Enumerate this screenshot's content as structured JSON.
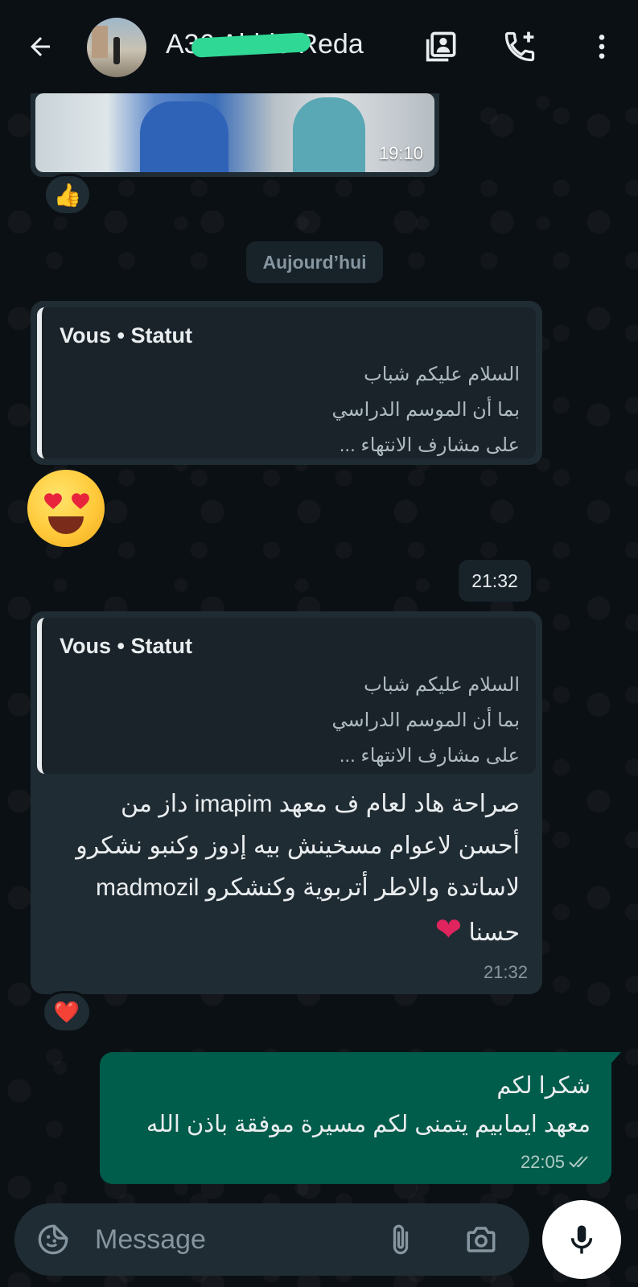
{
  "header": {
    "contact_name": "A36 Abide Reda",
    "icons": [
      "back-arrow-icon",
      "contact-card-icon",
      "add-call-icon",
      "more-vert-icon"
    ]
  },
  "media_message": {
    "time": "19:10",
    "reaction": "👍"
  },
  "date_divider": "Aujourd’hui",
  "status_reply_1": {
    "quote_author": "Vous • Statut",
    "quote_lines": [
      "السلام عليكم شباب",
      "بما أن الموسم الدراسي",
      "على مشارف الانتهاء ..."
    ],
    "reaction": "😍",
    "time": "21:32"
  },
  "status_reply_2": {
    "quote_author": "Vous • Statut",
    "quote_lines": [
      "السلام عليكم شباب",
      "بما أن الموسم الدراسي",
      "على مشارف الانتهاء ..."
    ],
    "message_lines": [
      "صراحة هاد لعام ف معهد imapim  داز من",
      "أحسن لاعوام مسخينش بيه إدوز وكنبو نشكرو",
      "لاساتدة والاطر أتربوية  وكنشكرو madmozil",
      "حسنا"
    ],
    "heart": "❤",
    "time": "21:32",
    "reaction": "❤️"
  },
  "outgoing_message": {
    "lines": [
      "شكرا لكم",
      "معهد ايمابيم يتمنى لكم مسيرة موفقة باذن الله"
    ],
    "time": "22:05",
    "status": "read"
  },
  "composer": {
    "placeholder": "Message",
    "icons": [
      "sticker-icon",
      "attach-icon",
      "camera-icon",
      "mic-icon"
    ]
  },
  "colors": {
    "background": "#0b1014",
    "incoming_bubble": "#202c33",
    "outgoing_bubble": "#005c4b",
    "accent": "#00a884"
  }
}
